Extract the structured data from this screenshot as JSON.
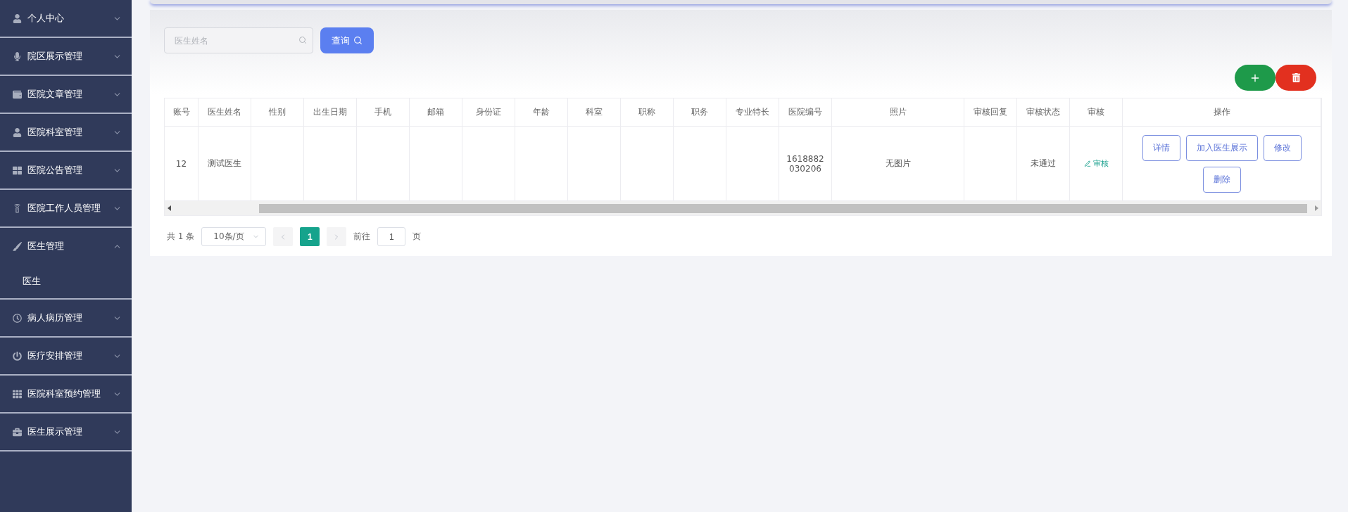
{
  "sidebar": {
    "items": [
      {
        "label": "个人中心",
        "expanded": false
      },
      {
        "label": "院区展示管理",
        "expanded": false
      },
      {
        "label": "医院文章管理",
        "expanded": false
      },
      {
        "label": "医院科室管理",
        "expanded": false
      },
      {
        "label": "医院公告管理",
        "expanded": false
      },
      {
        "label": "医院工作人员管理",
        "expanded": false
      },
      {
        "label": "医生管理",
        "expanded": true,
        "children": [
          {
            "label": "医生"
          }
        ]
      },
      {
        "label": "病人病历管理",
        "expanded": false
      },
      {
        "label": "医疗安排管理",
        "expanded": false
      },
      {
        "label": "医院科室预约管理",
        "expanded": false
      },
      {
        "label": "医生展示管理",
        "expanded": false
      }
    ]
  },
  "search": {
    "placeholder": "医生姓名",
    "button": "查询"
  },
  "table": {
    "columns": [
      {
        "label": "账号"
      },
      {
        "label": "医生姓名"
      },
      {
        "label": "性别"
      },
      {
        "label": "出生日期"
      },
      {
        "label": "手机"
      },
      {
        "label": "邮箱"
      },
      {
        "label": "身份证"
      },
      {
        "label": "年龄"
      },
      {
        "label": "科室"
      },
      {
        "label": "职称"
      },
      {
        "label": "职务"
      },
      {
        "label": "专业特长"
      },
      {
        "label": "医院编号"
      },
      {
        "label": "照片"
      },
      {
        "label": "审核回复"
      },
      {
        "label": "审核状态"
      },
      {
        "label": "审核"
      },
      {
        "label": "操作"
      }
    ],
    "rows": [
      {
        "cells": [
          {
            "kind": "text",
            "text": "12"
          },
          {
            "kind": "text",
            "text": "测试医生"
          },
          {
            "kind": "empty"
          },
          {
            "kind": "empty"
          },
          {
            "kind": "empty"
          },
          {
            "kind": "empty"
          },
          {
            "kind": "empty"
          },
          {
            "kind": "empty"
          },
          {
            "kind": "empty"
          },
          {
            "kind": "empty"
          },
          {
            "kind": "empty"
          },
          {
            "kind": "empty"
          },
          {
            "kind": "text",
            "text": "1618882 030206"
          },
          {
            "kind": "text",
            "text": "无图片"
          },
          {
            "kind": "empty"
          },
          {
            "kind": "text",
            "text": "未通过"
          },
          {
            "kind": "link",
            "text": "审核"
          },
          {
            "kind": "actions",
            "buttons": [
              "详情",
              "加入医生展示",
              "修改",
              "删除"
            ]
          }
        ]
      }
    ]
  },
  "pagination": {
    "total": "共 1 条",
    "page_size": "10条/页",
    "pages": [
      {
        "label": "1",
        "selected": true
      }
    ],
    "goto_label": "前往",
    "goto_value": "1",
    "goto_suffix": "页"
  }
}
